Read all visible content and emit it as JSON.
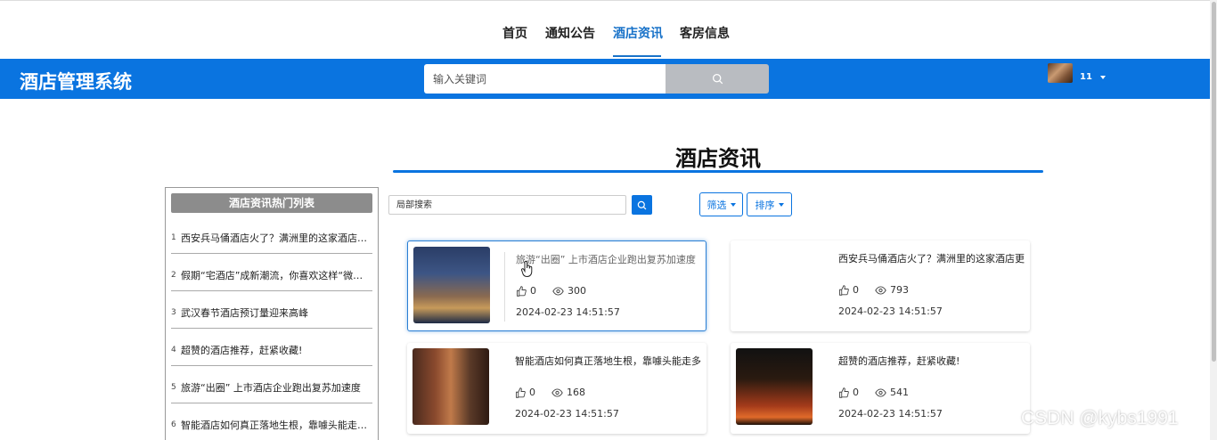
{
  "topnav": {
    "items": [
      {
        "label": "首页"
      },
      {
        "label": "通知公告"
      },
      {
        "label": "酒店资讯",
        "active": true
      },
      {
        "label": "客房信息"
      }
    ]
  },
  "header": {
    "brand": "酒店管理系统",
    "search_placeholder": "输入关键词",
    "user_name": "11",
    "bg_color": "#0a74e0"
  },
  "main": {
    "title": "酒店资讯",
    "local_search_placeholder": "局部搜索",
    "filter_label": "筛选",
    "sort_label": "排序"
  },
  "hotlist": {
    "title": "酒店资讯热门列表",
    "items": [
      {
        "num": "1",
        "text": "西安兵马俑酒店火了？满洲里的这家酒店更…"
      },
      {
        "num": "2",
        "text": "假期“宅酒店”成新潮流，你喜欢这样“微度假…"
      },
      {
        "num": "3",
        "text": "武汉春节酒店预订量迎来高峰"
      },
      {
        "num": "4",
        "text": "超赞的酒店推荐，赶紧收藏!"
      },
      {
        "num": "5",
        "text": "旅游“出圈” 上市酒店企业跑出复苏加速度"
      },
      {
        "num": "6",
        "text": "智能酒店如何真正落地生根，靠噱头能走多远"
      }
    ]
  },
  "cards": [
    {
      "title": "旅游“出圈” 上市酒店企业跑出复苏加速度",
      "likes": "0",
      "views": "300",
      "date": "2024-02-23 14:51:57"
    },
    {
      "title": "西安兵马俑酒店火了？满洲里的这家酒店更",
      "likes": "0",
      "views": "793",
      "date": "2024-02-23 14:51:57"
    },
    {
      "title": "智能酒店如何真正落地生根，靠噱头能走多",
      "likes": "0",
      "views": "168",
      "date": "2024-02-23 14:51:57"
    },
    {
      "title": "超赞的酒店推荐，赶紧收藏!",
      "likes": "0",
      "views": "541",
      "date": "2024-02-23 14:51:57"
    }
  ],
  "watermark": "CSDN @kybs1991"
}
